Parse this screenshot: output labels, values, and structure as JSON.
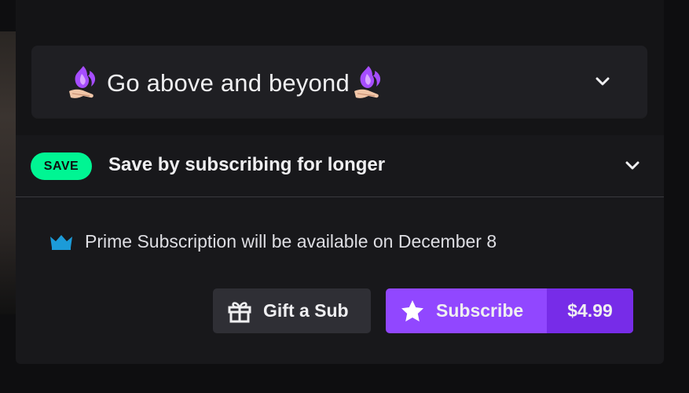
{
  "tier": {
    "title": "Go above and beyond",
    "left_emote": "purple-fire-hand-emote",
    "right_emote": "purple-fire-hand-emote",
    "expand_icon": "chevron-down-icon"
  },
  "save": {
    "badge": "SAVE",
    "text": "Save by subscribing for longer",
    "expand_icon": "chevron-down-icon",
    "badge_color": "#00f593"
  },
  "prime": {
    "icon": "crown-icon",
    "text": "Prime Subscription will be available on December 8",
    "icon_color": "#1c9bd8"
  },
  "actions": {
    "gift_label": "Gift a Sub",
    "gift_icon": "gift-icon",
    "subscribe_label": "Subscribe",
    "subscribe_icon": "star-icon",
    "price": "$4.99",
    "accent": "#9147ff",
    "accent_dark": "#772ce8"
  }
}
